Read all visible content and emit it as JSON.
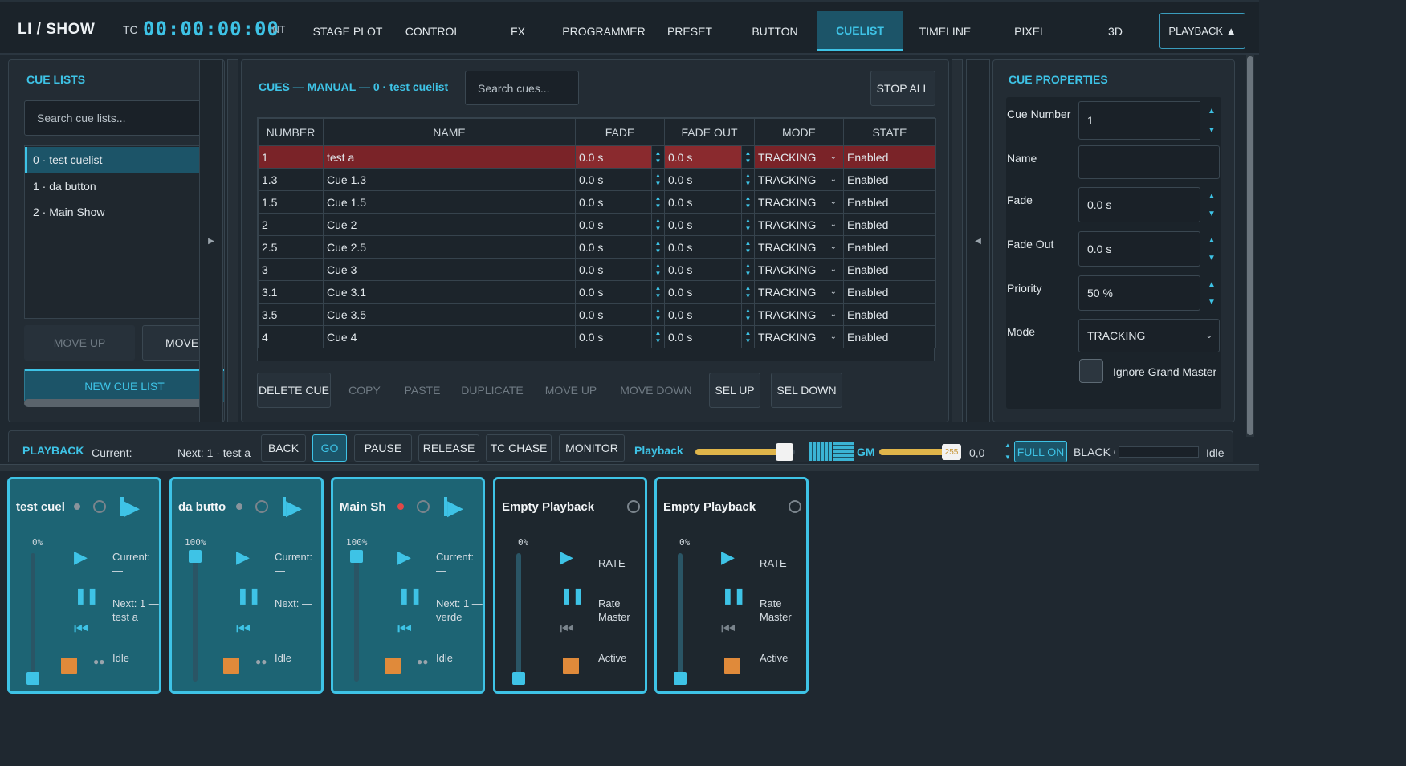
{
  "header": {
    "brand": "LI / SHOW",
    "tc_label": "TC",
    "tc_value": "00:00:00:00",
    "tc_mode": "INT",
    "tabs": [
      "STAGE PLOT",
      "CONTROL",
      "FX",
      "PROGRAMMER",
      "PRESET",
      "BUTTON",
      "CUELIST",
      "TIMELINE",
      "PIXEL",
      "3D"
    ],
    "active_tab": "CUELIST",
    "playback_tab": "PLAYBACK ▲"
  },
  "cue_lists": {
    "title": "CUE LISTS",
    "search_placeholder": "Search cue lists...",
    "items": [
      "0 · test cuelist",
      "1 · da button",
      "2 · Main Show"
    ],
    "selected_index": 0,
    "move_up": "MOVE UP",
    "move_down": "MOVE D",
    "new_list": "NEW CUE LIST"
  },
  "cues": {
    "title": "CUES — MANUAL — 0 · test cuelist",
    "search_placeholder": "Search cues...",
    "stop_all": "STOP ALL",
    "columns": [
      "NUMBER",
      "NAME",
      "FADE",
      "FADE OUT",
      "MODE",
      "STATE"
    ],
    "rows": [
      {
        "number": "1",
        "name": "test a",
        "fade": "0.0 s",
        "fade_out": "0.0 s",
        "mode": "TRACKING",
        "state": "Enabled"
      },
      {
        "number": "1.3",
        "name": "Cue 1.3",
        "fade": "0.0 s",
        "fade_out": "0.0 s",
        "mode": "TRACKING",
        "state": "Enabled"
      },
      {
        "number": "1.5",
        "name": "Cue 1.5",
        "fade": "0.0 s",
        "fade_out": "0.0 s",
        "mode": "TRACKING",
        "state": "Enabled"
      },
      {
        "number": "2",
        "name": "Cue 2",
        "fade": "0.0 s",
        "fade_out": "0.0 s",
        "mode": "TRACKING",
        "state": "Enabled"
      },
      {
        "number": "2.5",
        "name": "Cue 2.5",
        "fade": "0.0 s",
        "fade_out": "0.0 s",
        "mode": "TRACKING",
        "state": "Enabled"
      },
      {
        "number": "3",
        "name": "Cue 3",
        "fade": "0.0 s",
        "fade_out": "0.0 s",
        "mode": "TRACKING",
        "state": "Enabled"
      },
      {
        "number": "3.1",
        "name": "Cue 3.1",
        "fade": "0.0 s",
        "fade_out": "0.0 s",
        "mode": "TRACKING",
        "state": "Enabled"
      },
      {
        "number": "3.5",
        "name": "Cue 3.5",
        "fade": "0.0 s",
        "fade_out": "0.0 s",
        "mode": "TRACKING",
        "state": "Enabled"
      },
      {
        "number": "4",
        "name": "Cue 4",
        "fade": "0.0 s",
        "fade_out": "0.0 s",
        "mode": "TRACKING",
        "state": "Enabled"
      }
    ],
    "actions": [
      "DELETE CUE",
      "COPY",
      "PASTE",
      "DUPLICATE",
      "MOVE UP",
      "MOVE DOWN",
      "SEL UP",
      "SEL DOWN"
    ]
  },
  "properties": {
    "title": "CUE PROPERTIES",
    "cue_number_label": "Cue Number",
    "cue_number": "1",
    "name_label": "Name",
    "name": "",
    "fade_label": "Fade",
    "fade": "0.0 s",
    "fade_out_label": "Fade Out",
    "fade_out": "0.0 s",
    "priority_label": "Priority",
    "priority": "50 %",
    "mode_label": "Mode",
    "mode": "TRACKING",
    "ignore_gm_label": "Ignore Grand Master"
  },
  "playback": {
    "title": "PLAYBACK",
    "current": "Current: —",
    "next": "Next: 1 · test a",
    "buttons": [
      "BACK",
      "GO",
      "PAUSE",
      "RELEASE",
      "TC CHASE",
      "MONITOR"
    ],
    "playback_label": "Playback",
    "playback_level": 0.9,
    "gm_label": "GM",
    "gm_value": "255",
    "gm_level": 0.9,
    "rate_value": "0,0",
    "full_on": "FULL ON",
    "blackout": "BLACK O",
    "status": "Idle"
  },
  "faders": [
    {
      "title": "test cuel",
      "percent": "0%",
      "current": "Current: —",
      "next": "Next: 1 — test a",
      "status": "Idle",
      "level": 0.0,
      "dot_color": "#8a949c"
    },
    {
      "title": "da butto",
      "percent": "100%",
      "current": "Current: —",
      "next": "Next: —",
      "status": "Idle",
      "level": 1.0,
      "dot_color": "#8a949c"
    },
    {
      "title": "Main Sh",
      "percent": "100%",
      "current": "Current: —",
      "next": "Next: 1 — verde",
      "status": "Idle",
      "level": 1.0,
      "dot_color": "#e04848"
    },
    {
      "title": "Empty Playback",
      "percent": "0%",
      "rate": "RATE",
      "rate_master": "Rate Master",
      "status": "Active",
      "level": 0.0
    },
    {
      "title": "Empty Playback",
      "percent": "0%",
      "rate": "RATE",
      "rate_master": "Rate Master",
      "status": "Active",
      "level": 0.0
    }
  ]
}
